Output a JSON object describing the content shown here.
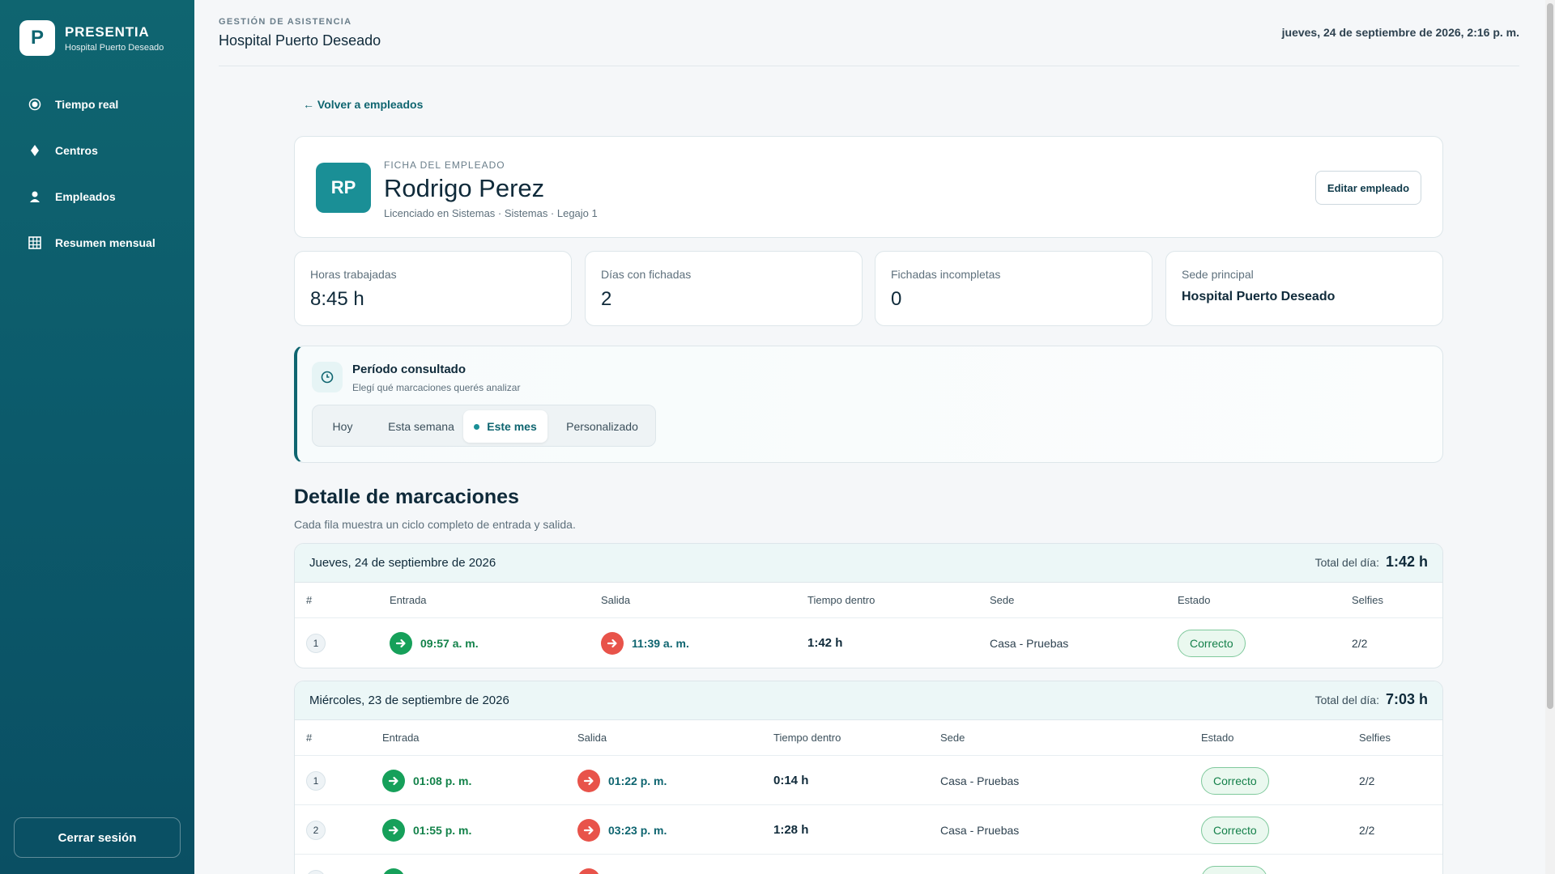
{
  "brand": {
    "logo_letter": "P",
    "name": "PRESENTIA",
    "subtitle": "Hospital Puerto Deseado"
  },
  "nav": {
    "items": [
      {
        "label": "Tiempo real",
        "icon": "radio-icon"
      },
      {
        "label": "Centros",
        "icon": "diamond-icon"
      },
      {
        "label": "Empleados",
        "icon": "person-icon"
      },
      {
        "label": "Resumen mensual",
        "icon": "grid-icon"
      }
    ],
    "logout_label": "Cerrar sesión"
  },
  "header": {
    "eyebrow": "GESTIÓN DE ASISTENCIA",
    "title": "Hospital Puerto Deseado",
    "datetime": "jueves, 24 de septiembre de 2026, 2:16 p. m."
  },
  "back_link": "← Volver a empleados",
  "employee": {
    "initials": "RP",
    "eyebrow": "FICHA DEL EMPLEADO",
    "name": "Rodrigo Perez",
    "details": "Licenciado en Sistemas · Sistemas · Legajo 1",
    "edit_label": "Editar empleado"
  },
  "stats": [
    {
      "label": "Horas trabajadas",
      "value": "8:45 h"
    },
    {
      "label": "Días con fichadas",
      "value": "2"
    },
    {
      "label": "Fichadas incompletas",
      "value": "0"
    },
    {
      "label": "Sede principal",
      "value": "Hospital Puerto Deseado"
    }
  ],
  "period": {
    "title": "Período consultado",
    "subtitle": "Elegí qué marcaciones querés analizar",
    "options": [
      "Hoy",
      "Esta semana",
      "Este mes",
      "Personalizado"
    ],
    "selected": "Este mes"
  },
  "detail": {
    "title": "Detalle de marcaciones",
    "subtitle": "Cada fila muestra un ciclo completo de entrada y salida.",
    "columns": [
      "#",
      "Entrada",
      "Salida",
      "Tiempo dentro",
      "Sede",
      "Estado",
      "Selfies"
    ],
    "total_label": "Total del día:",
    "days": [
      {
        "date": "Jueves, 24 de septiembre de 2026",
        "total": "1:42 h",
        "rows": [
          {
            "n": "1",
            "entrada": "09:57 a. m.",
            "salida": "11:39 a. m.",
            "tiempo": "1:42 h",
            "sede": "Casa - Pruebas",
            "estado": "Correcto",
            "selfies": "2/2"
          }
        ]
      },
      {
        "date": "Miércoles, 23 de septiembre de 2026",
        "total": "7:03 h",
        "rows": [
          {
            "n": "1",
            "entrada": "01:08 p. m.",
            "salida": "01:22 p. m.",
            "tiempo": "0:14 h",
            "sede": "Casa - Pruebas",
            "estado": "Correcto",
            "selfies": "2/2"
          },
          {
            "n": "2",
            "entrada": "01:55 p. m.",
            "salida": "03:23 p. m.",
            "tiempo": "1:28 h",
            "sede": "Casa - Pruebas",
            "estado": "Correcto",
            "selfies": "2/2"
          }
        ]
      }
    ]
  },
  "colors": {
    "sidebar": "#0f6570",
    "accent": "#1a8f96",
    "in": "#16a05a",
    "out": "#e8534a",
    "status_ok": "#14804a"
  }
}
